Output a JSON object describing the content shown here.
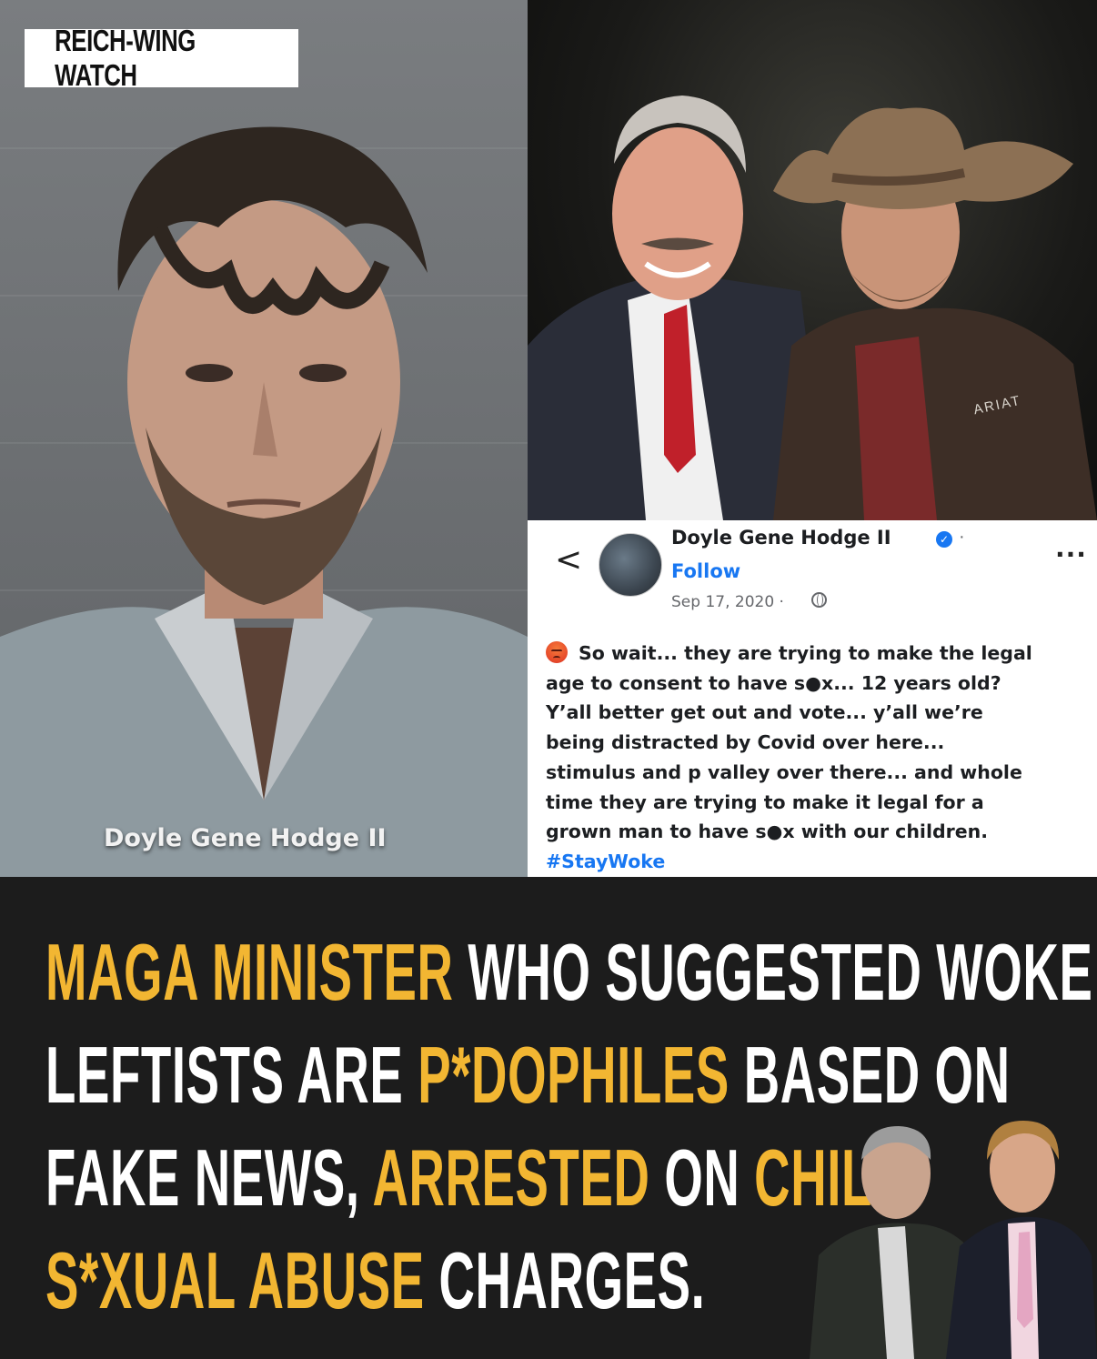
{
  "brand": {
    "label": "REICH-WING WATCH"
  },
  "mugshot": {
    "caption": "Doyle Gene Hodge II"
  },
  "photo": {
    "jacket_logo": "ARIAT"
  },
  "post": {
    "author": "Doyle Gene Hodge II",
    "follow_label": "Follow",
    "date": "Sep 17, 2020 ·",
    "more_label": "...",
    "back_label": "<",
    "name_separator": "·",
    "lines": [
      "So wait... they are trying to make the legal",
      "age to consent to have s●x... 12 years old?",
      "Y’all better get out and vote... y’all we’re",
      "being distracted by Covid over here...",
      "stimulus and p valley over there... and whole",
      "time they are trying to make it legal for a",
      "grown man to have s●x with our children."
    ],
    "hashtag": "#StayWoke"
  },
  "headline": {
    "rows": [
      [
        {
          "t": "MAGA MINISTER ",
          "c": "y"
        },
        {
          "t": "WHO SUGGESTED WOKE",
          "c": "w"
        }
      ],
      [
        {
          "t": "LEFTISTS ARE ",
          "c": "w"
        },
        {
          "t": "P*DOPHILES ",
          "c": "y"
        },
        {
          "t": "BASED ON",
          "c": "w"
        }
      ],
      [
        {
          "t": "FAKE NEWS, ",
          "c": "w"
        },
        {
          "t": "ARRESTED ",
          "c": "y"
        },
        {
          "t": "ON ",
          "c": "w"
        },
        {
          "t": "CHILD",
          "c": "y"
        }
      ],
      [
        {
          "t": "S*XUAL ABUSE ",
          "c": "y"
        },
        {
          "t": "CHARGES.",
          "c": "w"
        }
      ]
    ]
  },
  "colors": {
    "accent_yellow": "#f2b632",
    "headline_white": "#ffffff",
    "background": "#1c1c1c",
    "link_blue": "#1877f2"
  }
}
